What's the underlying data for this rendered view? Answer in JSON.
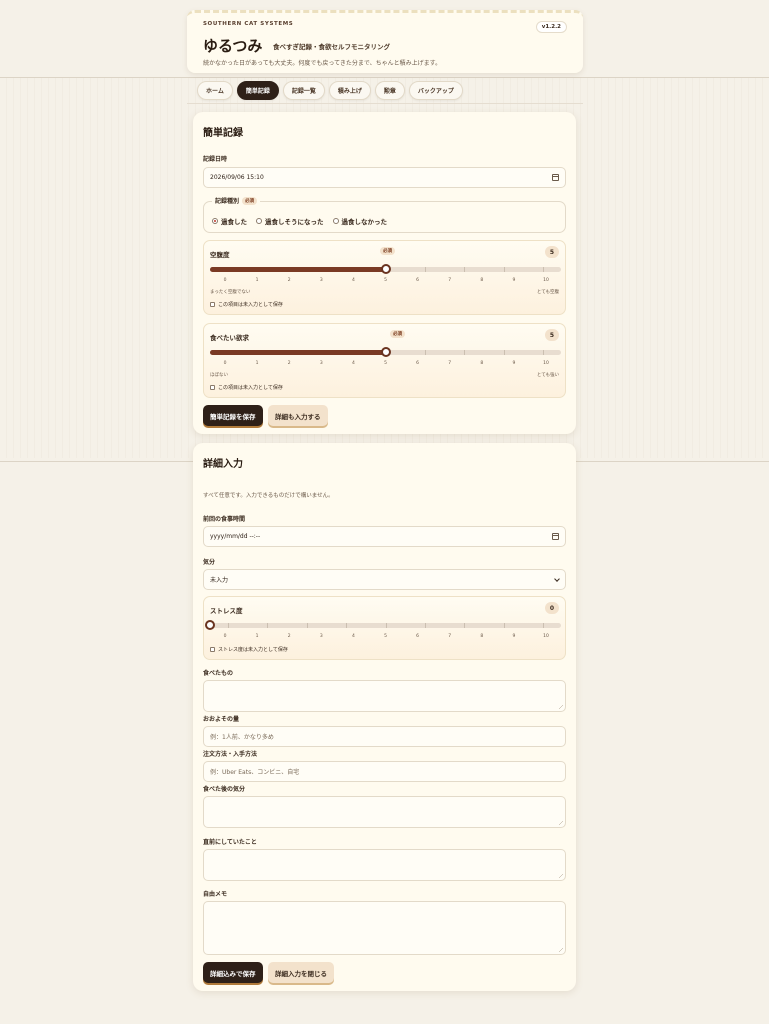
{
  "header": {
    "brand": "SOUTHERN CAT SYSTEMS",
    "version": "v1.2.2",
    "title": "ゆるつみ",
    "subtitle": "食べすぎ記録・食欲セルフモニタリング",
    "tagline": "続かなかった日があっても大丈夫。何度でも戻ってきた分まで、ちゃんと積み上げます。"
  },
  "tabs": [
    {
      "label": "ホーム",
      "active": false
    },
    {
      "label": "簡単記録",
      "active": true
    },
    {
      "label": "記録一覧",
      "active": false
    },
    {
      "label": "積み上げ",
      "active": false
    },
    {
      "label": "勲章",
      "active": false
    },
    {
      "label": "バックアップ",
      "active": false
    }
  ],
  "quick": {
    "title": "簡単記録",
    "datetime_label": "記録日時",
    "datetime_value": "2026/09/06 15:10",
    "type_label": "記録種別",
    "required": "必須",
    "type_options": [
      "過食した",
      "過食しそうになった",
      "過食しなかった"
    ],
    "type_selected": 0,
    "hunger": {
      "label": "空腹度",
      "value": 5,
      "min": 0,
      "max": 10,
      "low_label": "まったく空腹でない",
      "high_label": "とても空腹",
      "skip_label": "この項目は未入力として保存"
    },
    "craving": {
      "label": "食べたい欲求",
      "value": 5,
      "min": 0,
      "max": 10,
      "low_label": "ほぼない",
      "high_label": "とても強い",
      "skip_label": "この項目は未入力として保存"
    },
    "save_button": "簡単記録を保存",
    "detail_button": "詳細も入力する"
  },
  "detail": {
    "title": "詳細入力",
    "note": "すべて任意です。入力できるものだけで構いません。",
    "last_meal_label": "前回の食事時間",
    "last_meal_placeholder": "yyyy/mm/dd --:--",
    "mood_label": "気分",
    "mood_value": "未入力",
    "stress": {
      "label": "ストレス度",
      "value": 0,
      "min": 0,
      "max": 10,
      "skip_label": "ストレス度は未入力として保存"
    },
    "food_label": "食べたもの",
    "amount_label": "おおよその量",
    "amount_placeholder": "例：1人前、かなり多め",
    "order_label": "注文方法・入手方法",
    "order_placeholder": "例：Uber Eats、コンビニ、自宅",
    "after_feel_label": "食べた後の気分",
    "before_label": "直前にしていたこと",
    "memo_label": "自由メモ",
    "save_button": "詳細込みで保存",
    "close_button": "詳細入力を閉じる"
  },
  "tick_labels": [
    "0",
    "1",
    "2",
    "3",
    "4",
    "5",
    "6",
    "7",
    "8",
    "9",
    "10"
  ]
}
